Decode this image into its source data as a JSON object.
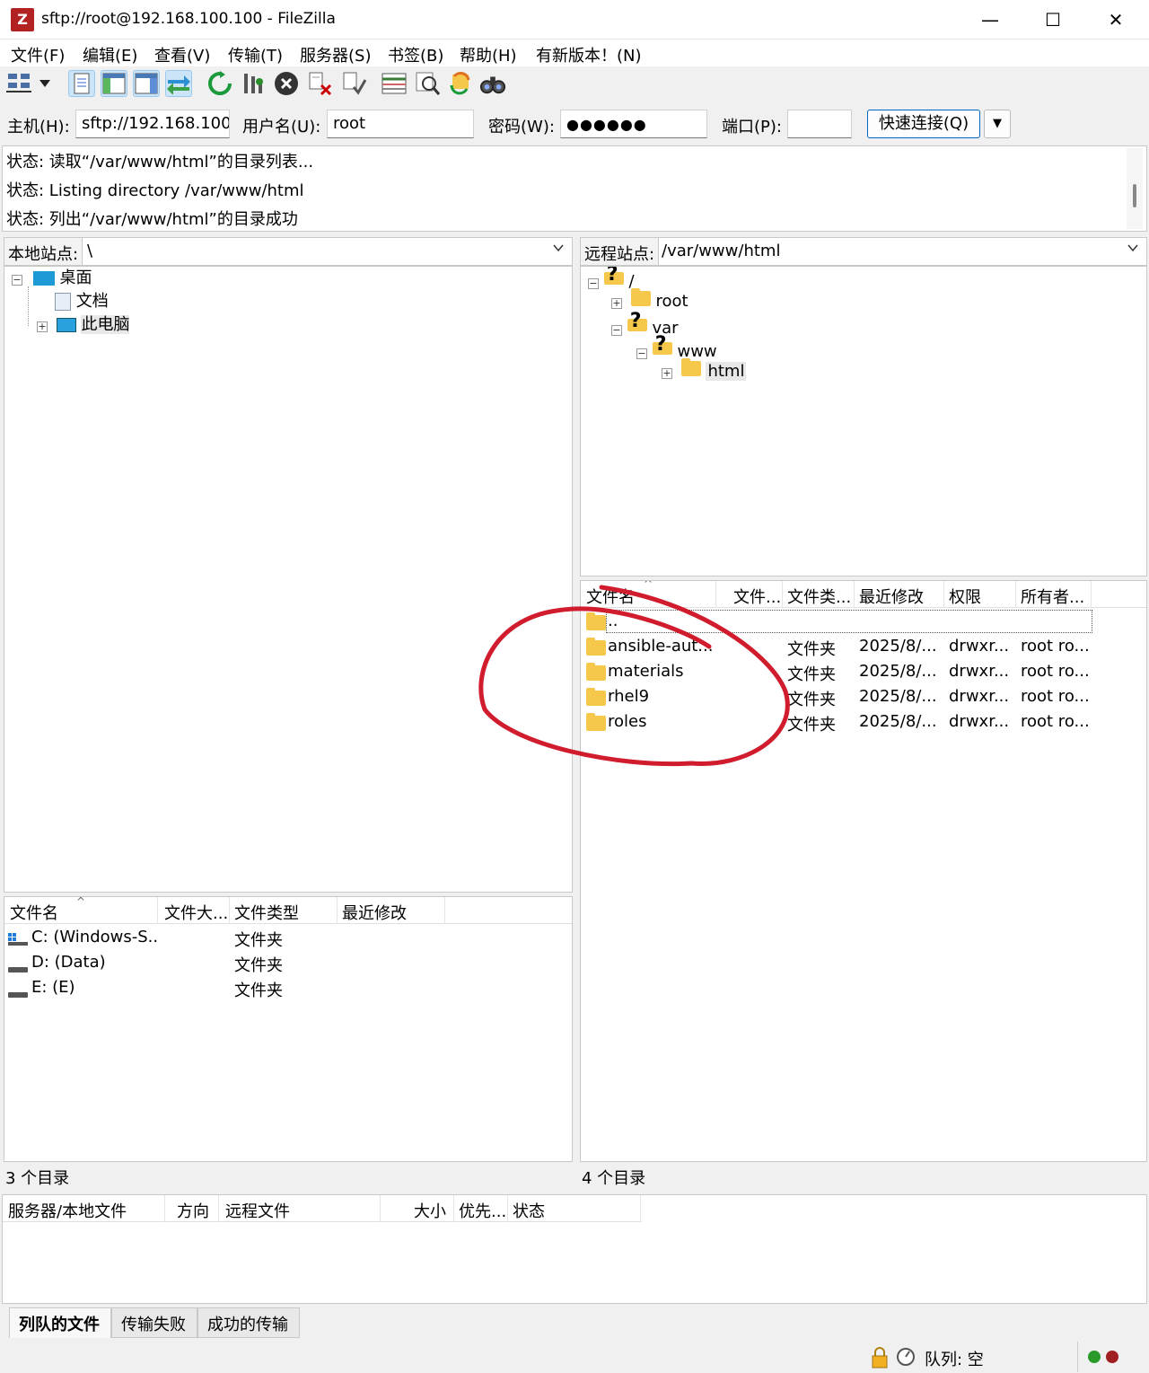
{
  "window": {
    "title": "sftp://root@192.168.100.100 - FileZilla",
    "app_icon": "Z",
    "minimize": "—",
    "maximize": "☐",
    "close": "✕"
  },
  "menu": [
    "文件(F)",
    "编辑(E)",
    "查看(V)",
    "传输(T)",
    "服务器(S)",
    "书签(B)",
    "帮助(H)",
    "有新版本！(N)"
  ],
  "toolbar": {
    "icons": [
      "site-manager-icon",
      "dropdown-arrow-icon",
      "toggle-log-icon",
      "toggle-local-tree-icon",
      "toggle-remote-tree-icon",
      "toggle-queue-icon",
      "refresh-icon",
      "process-queue-icon",
      "cancel-icon",
      "disconnect-icon",
      "reconnect-icon",
      "directory-compare-icon",
      "filter-icon",
      "sync-browse-icon",
      "search-icon"
    ]
  },
  "quickconnect": {
    "host_label": "主机(H):",
    "host_value": "sftp://192.168.100.",
    "user_label": "用户名(U):",
    "user_value": "root",
    "pass_label": "密码(W):",
    "pass_value": "●●●●●●",
    "port_label": "端口(P):",
    "port_value": "",
    "button": "快速连接(Q)",
    "dropdown": "▼"
  },
  "log": [
    "状态: 读取“/var/www/html”的目录列表...",
    "状态: Listing directory /var/www/html",
    "状态: 列出“/var/www/html”的目录成功"
  ],
  "local": {
    "site_label": "本地站点:",
    "path": "\\",
    "tree": [
      {
        "label": "桌面",
        "expander": "⊟"
      },
      {
        "label": "文档"
      },
      {
        "label": "此电脑",
        "expander": "⊞"
      }
    ],
    "columns": [
      "文件名",
      "文件大...",
      "文件类型",
      "最近修改"
    ],
    "files": [
      {
        "name": "C: (Windows-S...",
        "type": "文件夹"
      },
      {
        "name": "D: (Data)",
        "type": "文件夹"
      },
      {
        "name": "E: (E)",
        "type": "文件夹"
      }
    ],
    "status": "3 个目录"
  },
  "remote": {
    "site_label": "远程站点:",
    "path": "/var/www/html",
    "tree": [
      {
        "label": "/"
      },
      {
        "label": "root"
      },
      {
        "label": "var"
      },
      {
        "label": "www"
      },
      {
        "label": "html"
      }
    ],
    "columns": [
      "文件名",
      "文件...",
      "文件类...",
      "最近修改",
      "权限",
      "所有者..."
    ],
    "files": [
      {
        "name": "..",
        "type": "",
        "modified": "",
        "perms": "",
        "owner": ""
      },
      {
        "name": "ansible-aut...",
        "type": "文件夹",
        "modified": "2025/8/...",
        "perms": "drwxr...",
        "owner": "root ro..."
      },
      {
        "name": "materials",
        "type": "文件夹",
        "modified": "2025/8/...",
        "perms": "drwxr...",
        "owner": "root ro..."
      },
      {
        "name": "rhel9",
        "type": "文件夹",
        "modified": "2025/8/...",
        "perms": "drwxr...",
        "owner": "root ro..."
      },
      {
        "name": "roles",
        "type": "文件夹",
        "modified": "2025/8/...",
        "perms": "drwxr...",
        "owner": "root ro..."
      }
    ],
    "status": "4 个目录"
  },
  "queue": {
    "columns": [
      "服务器/本地文件",
      "方向",
      "远程文件",
      "大小",
      "优先...",
      "状态"
    ]
  },
  "tabs": [
    "列队的文件",
    "传输失败",
    "成功的传输"
  ],
  "statusbar": {
    "queue": "队列: 空"
  },
  "annotation_color": "#d01c2c"
}
